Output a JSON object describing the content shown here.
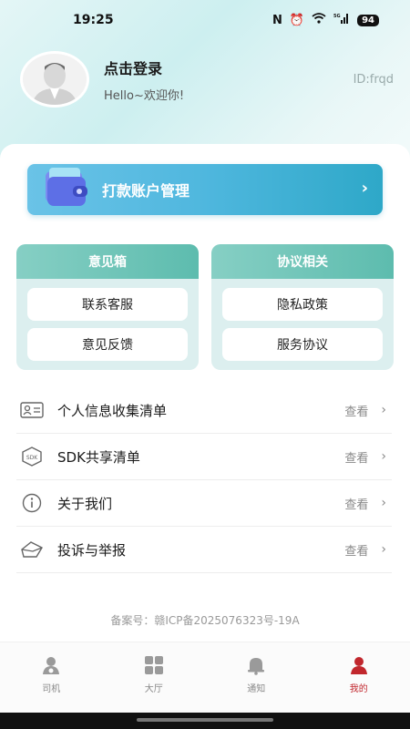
{
  "status_bar": {
    "time": "19:25",
    "battery": "94",
    "signal": "5G"
  },
  "profile": {
    "login_title": "点击登录",
    "greeting": "Hello~欢迎你!",
    "user_id": "ID:frqd"
  },
  "account_button": {
    "label": "打款账户管理",
    "chevron": "›"
  },
  "feedback_panel": {
    "title": "意见箱",
    "items": [
      "联系客服",
      "意见反馈"
    ]
  },
  "agreement_panel": {
    "title": "协议相关",
    "items": [
      "隐私政策",
      "服务协议"
    ]
  },
  "menu": [
    {
      "label": "个人信息收集清单",
      "action": "查看",
      "icon": "id-card-icon"
    },
    {
      "label": "SDK共享清单",
      "action": "查看",
      "icon": "sdk-box-icon"
    },
    {
      "label": "关于我们",
      "action": "查看",
      "icon": "info-icon"
    },
    {
      "label": "投诉与举报",
      "action": "查看",
      "icon": "envelope-icon"
    }
  ],
  "icp": "备案号：赣ICP备2025076323号-19A",
  "tabs": [
    {
      "label": "司机",
      "icon": "driver-icon"
    },
    {
      "label": "大厅",
      "icon": "hall-grid-icon"
    },
    {
      "label": "通知",
      "icon": "bell-icon"
    },
    {
      "label": "我的",
      "icon": "person-icon"
    }
  ],
  "colors": {
    "accent": "#2ea8c8",
    "panel_header": "#5dbcae",
    "active_tab": "#c1272d"
  }
}
